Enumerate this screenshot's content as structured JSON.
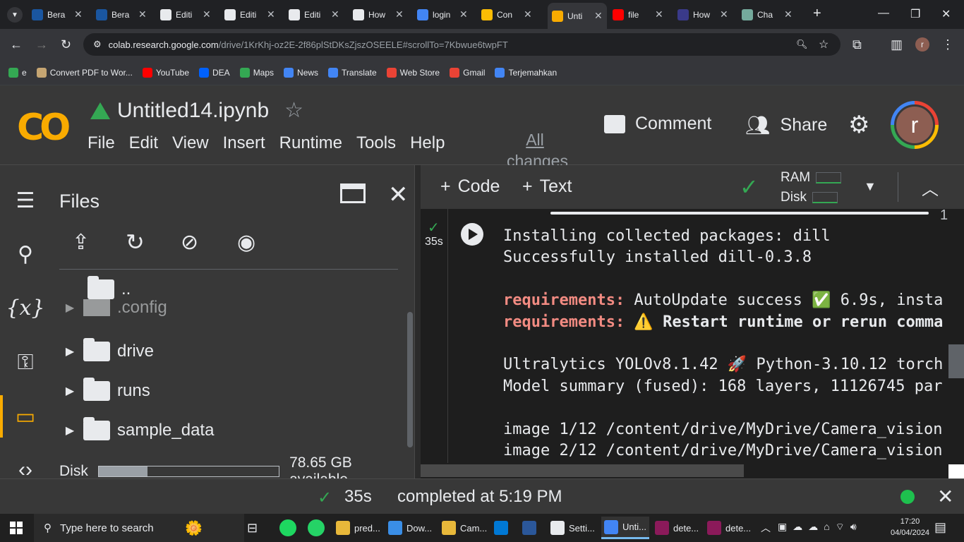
{
  "browser": {
    "tabs": [
      {
        "label": "Bera",
        "fav_color": "#1a56a0"
      },
      {
        "label": "Bera",
        "fav_color": "#1a56a0"
      },
      {
        "label": "Editi",
        "fav_color": "#e8eaed"
      },
      {
        "label": "Editi",
        "fav_color": "#e8eaed"
      },
      {
        "label": "Editi",
        "fav_color": "#e8eaed"
      },
      {
        "label": "How",
        "fav_color": "#e8eaed"
      },
      {
        "label": "login",
        "fav_color": "#4285f4"
      },
      {
        "label": "Con",
        "fav_color": "#fbbc04"
      },
      {
        "label": "Unti",
        "fav_color": "#f9ab00"
      },
      {
        "label": "file",
        "fav_color": "#ff0000"
      },
      {
        "label": "How",
        "fav_color": "#3a3a8a"
      },
      {
        "label": "Cha",
        "fav_color": "#74aa9c"
      }
    ],
    "url_host": "colab.research.google.com",
    "url_path": "/drive/1KrKhj-oz2E-2f86plStDKsZjszOSEELE#scrollTo=7Kbwue6twpFT",
    "avatar_letter": "r",
    "bookmarks": [
      {
        "label": "e",
        "color": "#34a853"
      },
      {
        "label": "Convert PDF to Wor...",
        "color": "#c5a572"
      },
      {
        "label": "YouTube",
        "color": "#ff0000"
      },
      {
        "label": "DEA",
        "color": "#0061fe"
      },
      {
        "label": "Maps",
        "color": "#34a853"
      },
      {
        "label": "News",
        "color": "#4285f4"
      },
      {
        "label": "Translate",
        "color": "#4285f4"
      },
      {
        "label": "Web Store",
        "color": "#ea4335"
      },
      {
        "label": "Gmail",
        "color": "#ea4335"
      },
      {
        "label": "Terjemahkan",
        "color": "#4285f4"
      }
    ]
  },
  "colab": {
    "logo": "CO",
    "notebook_title": "Untitled14.ipynb",
    "menu": [
      "File",
      "Edit",
      "View",
      "Insert",
      "Runtime",
      "Tools",
      "Help"
    ],
    "all_changes": "All changes",
    "comment_label": "Comment",
    "share_label": "Share",
    "avatar_letter": "r"
  },
  "files_panel": {
    "title": "Files",
    "tree": [
      {
        "name": "..",
        "expandable": false
      },
      {
        "name": ".config",
        "expandable": true
      },
      {
        "name": "drive",
        "expandable": true
      },
      {
        "name": "runs",
        "expandable": true
      },
      {
        "name": "sample_data",
        "expandable": true
      }
    ],
    "disk_label": "Disk",
    "disk_used_fraction": 0.27,
    "disk_available": "78.65 GB available"
  },
  "toolbar": {
    "code_label": "Code",
    "text_label": "Text",
    "ram_label": "RAM",
    "disk_label": "Disk"
  },
  "cell": {
    "exec_time": "35s",
    "line_number": "1",
    "output": [
      {
        "text": "Installing collected packages: dill",
        "style": "plain"
      },
      {
        "text": "Successfully installed dill-0.3.8",
        "style": "plain"
      },
      {
        "text": "",
        "style": "plain"
      },
      {
        "prefix": "requirements:",
        "text": " AutoUpdate success ✅ 6.9s, insta",
        "style": "req"
      },
      {
        "prefix": "requirements:",
        "text": " ⚠️ Restart runtime or rerun comma",
        "style": "req-bold"
      },
      {
        "text": "",
        "style": "plain"
      },
      {
        "text": "Ultralytics YOLOv8.1.42 🚀 Python-3.10.12 torch",
        "style": "plain"
      },
      {
        "text": "Model summary (fused): 168 layers, 11126745 par",
        "style": "plain"
      },
      {
        "text": "",
        "style": "plain"
      },
      {
        "text": "image 1/12 /content/drive/MyDrive/Camera_vision",
        "style": "plain"
      },
      {
        "text": "image 2/12 /content/drive/MyDrive/Camera_vision",
        "style": "plain"
      }
    ]
  },
  "status": {
    "exec_time": "35s",
    "completed_text": "completed at 5:19 PM"
  },
  "taskbar": {
    "search_placeholder": "Type here to search",
    "items": [
      {
        "label": "pred...",
        "color": "#e8b83a"
      },
      {
        "label": "Dow...",
        "color": "#3a8ee6"
      },
      {
        "label": "Cam...",
        "color": "#e8b83a"
      },
      {
        "label": "",
        "color": "#0078d4"
      },
      {
        "label": "",
        "color": "#2b579a"
      },
      {
        "label": "Setti...",
        "color": "#e8eaed"
      },
      {
        "label": "Unti...",
        "color": "#4285f4"
      },
      {
        "label": "dete...",
        "color": "#8b1a5a"
      },
      {
        "label": "dete...",
        "color": "#8b1a5a"
      }
    ],
    "time": "17:20",
    "date": "04/04/2024"
  }
}
